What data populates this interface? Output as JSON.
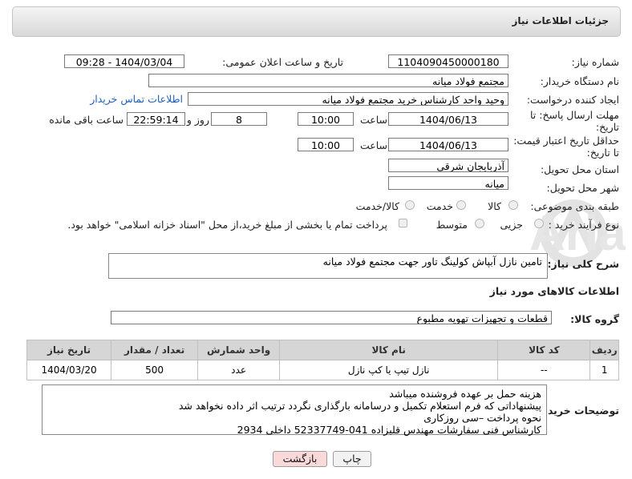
{
  "header": {
    "title": "جزئیات اطلاعات نیاز"
  },
  "fields": {
    "need_number": {
      "label": "شماره نیاز:",
      "value": "1104090450000180"
    },
    "announce_datetime": {
      "label": "تاریخ و ساعت اعلان عمومی:",
      "value": "1404/03/04 - 09:28"
    },
    "buyer_org": {
      "label": "نام دستگاه خریدار:",
      "value": "مجتمع فولاد میانه"
    },
    "requester": {
      "label": "ایجاد کننده درخواست:",
      "value": "وحید واحد کارشناس خرید مجتمع فولاد میانه",
      "contact_link": "اطلاعات تماس خریدار"
    },
    "reply_deadline": {
      "label_1": "مهلت ارسال پاسخ: تا",
      "label_2": "تاریخ:",
      "date": "1404/06/13",
      "time_label": "ساعت",
      "time": "10:00",
      "days": "8",
      "days_label": "روز و",
      "remaining_time": "22:59:14",
      "remaining_label": "ساعت باقی مانده"
    },
    "price_validity": {
      "label_1": "حداقل تاریخ اعتبار قیمت:",
      "label_2": "تا تاریخ:",
      "date": "1404/06/13",
      "time_label": "ساعت",
      "time": "10:00"
    },
    "province": {
      "label": "استان محل تحویل:",
      "value": "آذربایجان شرقی"
    },
    "city": {
      "label": "شهر محل تحویل:",
      "value": "میانه"
    },
    "category": {
      "label": "طبقه بندی موضوعی:",
      "options": [
        "کالا",
        "خدمت",
        "کالا/خدمت"
      ]
    },
    "process_type": {
      "label": "نوع فرآیند خرید :",
      "options": [
        "جزیی",
        "متوسط"
      ],
      "payment_note": "پرداخت تمام یا بخشی از مبلغ خرید،از محل \"اسناد خزانه اسلامی\" خواهد بود."
    },
    "need_description": {
      "label": "شرح کلی نیاز:",
      "value": "تامین نازل آبپاش کولینگ تاور جهت مجتمع فولاد میانه"
    }
  },
  "goods_section": {
    "title": "اطلاعات کالاهای مورد نیاز",
    "group_label": "گروه کالا:",
    "group_value": "قطعات و تجهیزات تهویه مطبوع",
    "table": {
      "headers": [
        "ردیف",
        "کد کالا",
        "نام کالا",
        "واحد شمارش",
        "تعداد / مقدار",
        "تاریخ نیاز"
      ],
      "rows": [
        [
          "1",
          "--",
          "نازل تیپ یا کپ نازل",
          "عدد",
          "500",
          "1404/03/20"
        ]
      ]
    }
  },
  "buyer_notes": {
    "label": "توضیحات خریدار:",
    "lines": [
      "هزینه حمل بر عهده فروشنده میباشد",
      "پیشنهاداتی که فرم استعلام تکمیل و درسامانه بارگذاری نگردد ترتیب اثر داده نخواهد شد",
      "نحوه پرداخت –سی روزکاری",
      "کارشناس فنی سفارشات مهندس قلیزاده   041-52337749  داخلی 2934"
    ]
  },
  "buttons": {
    "print": "چاپ",
    "back": "بازگشت"
  },
  "watermark": {
    "text": "AriaTender.net"
  },
  "colors": {
    "link": "#1f5fbf",
    "back_button_bg": "#f9d9d9",
    "header_bg": "#e3e3e3"
  }
}
